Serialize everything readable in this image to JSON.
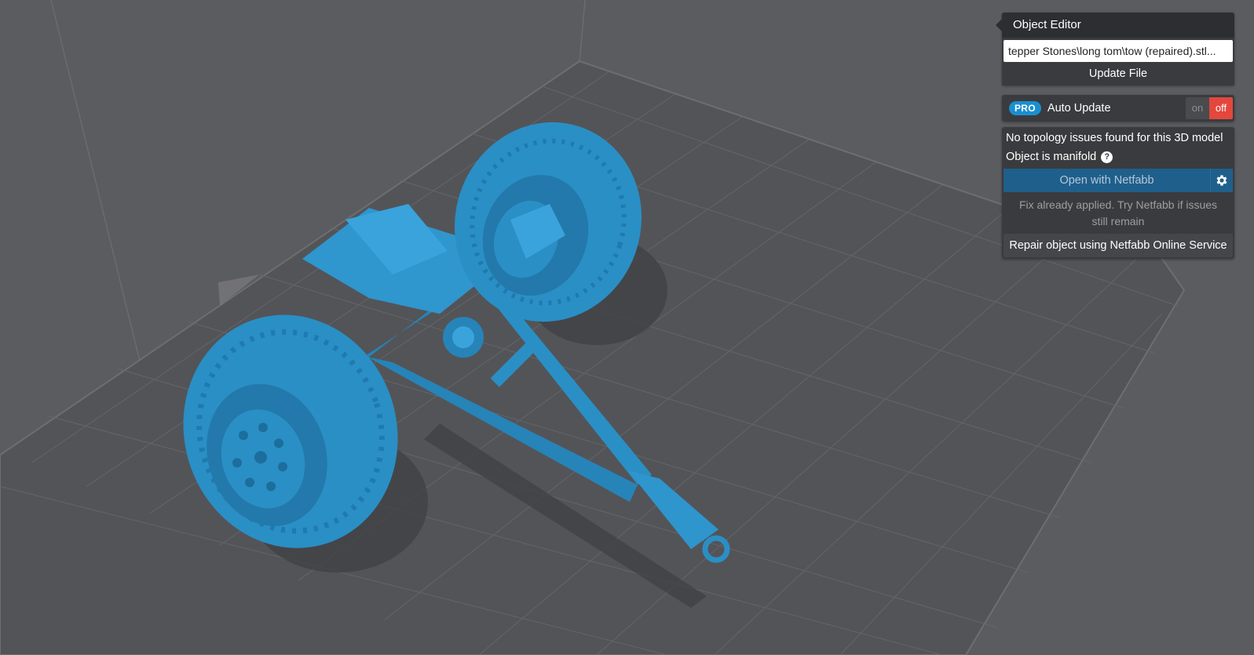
{
  "object_editor": {
    "title": "Object Editor",
    "file_path": "...tepper Stones\\long tom\\tow (repaired).stl",
    "update_label": "Update File"
  },
  "auto_update": {
    "badge": "PRO",
    "label": "Auto Update",
    "on_label": "on",
    "off_label": "off",
    "state": "off"
  },
  "topology": {
    "status": "No topology issues found for this 3D model",
    "manifold": "Object is manifold",
    "help_icon": "question-icon",
    "open_netfabb_label": "Open with Netfabb",
    "settings_icon": "gear-icon",
    "fix_note": "Fix already applied. Try Netfabb if issues still remain",
    "repair_label": "Repair object using Netfabb Online Service"
  },
  "viewport": {
    "model_color": "#2a8fc5",
    "background_color": "#5a5b5f",
    "grid_color": "#6e6f73"
  },
  "colors": {
    "accent_blue": "#1a8fd0",
    "toggle_off_red": "#e4473c",
    "panel_bg": "#3a3b3e"
  }
}
